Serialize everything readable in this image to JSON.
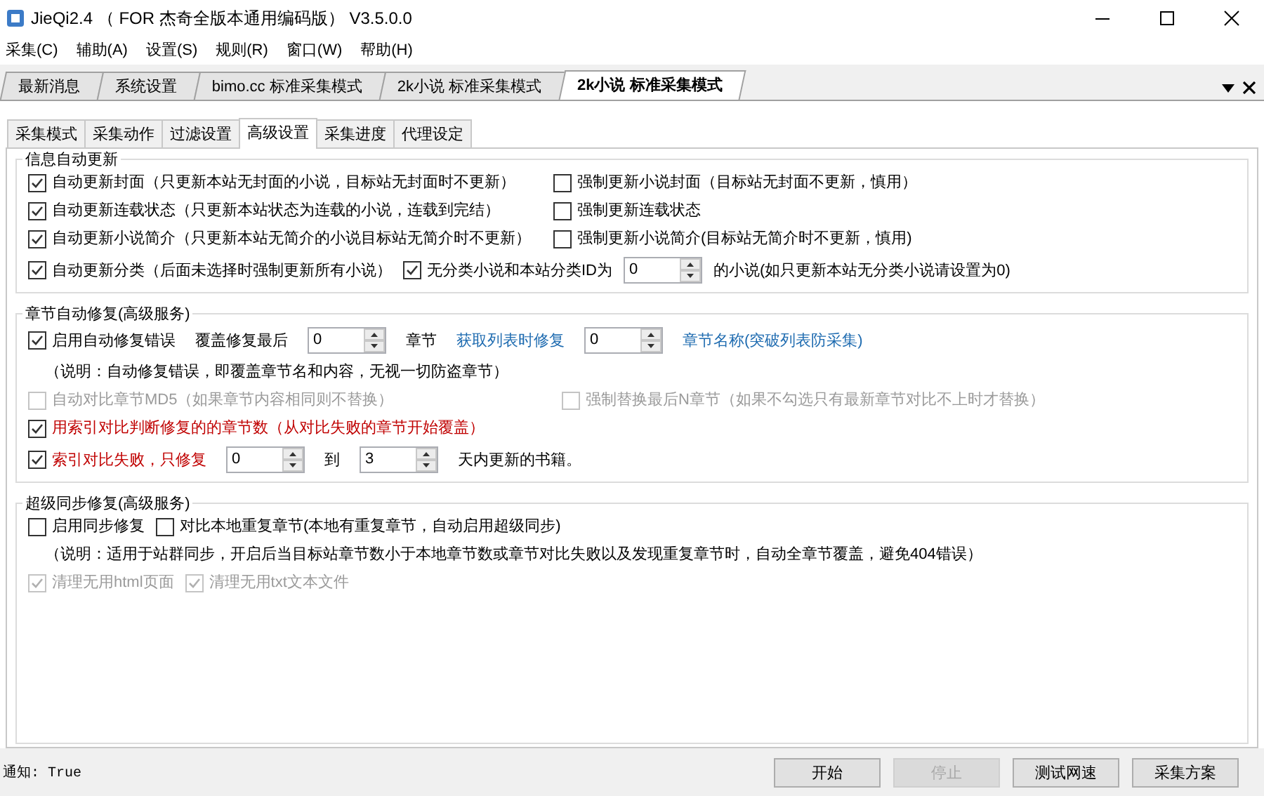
{
  "window": {
    "title": "JieQi2.4 （ FOR 杰奇全版本通用编码版） V3.5.0.0"
  },
  "menu": [
    {
      "label": "采集(C)"
    },
    {
      "label": "辅助(A)"
    },
    {
      "label": "设置(S)"
    },
    {
      "label": "规则(R)"
    },
    {
      "label": "窗口(W)"
    },
    {
      "label": "帮助(H)"
    }
  ],
  "doc_tabs": [
    {
      "label": "最新消息",
      "selected": false
    },
    {
      "label": "系统设置",
      "selected": false
    },
    {
      "label": "bimo.cc 标准采集模式",
      "selected": false
    },
    {
      "label": "2k小说 标准采集模式",
      "selected": false
    },
    {
      "label": "2k小说 标准采集模式",
      "selected": true
    }
  ],
  "sub_tabs": [
    {
      "label": "采集模式",
      "selected": false
    },
    {
      "label": "采集动作",
      "selected": false
    },
    {
      "label": "过滤设置",
      "selected": false
    },
    {
      "label": "高级设置",
      "selected": true
    },
    {
      "label": "采集进度",
      "selected": false
    },
    {
      "label": "代理设定",
      "selected": false
    }
  ],
  "groups": [
    {
      "title": "信息自动更新",
      "rows": [
        {
          "kind": "columns",
          "items": [
            {
              "kind": "check",
              "label": "自动更新封面（只更新本站无封面的小说，目标站无封面时不更新）",
              "checked": true,
              "disabled": false,
              "highlighted": false
            },
            {
              "kind": "check",
              "label": "强制更新小说封面（目标站无封面不更新，慎用）",
              "checked": false,
              "disabled": false,
              "highlighted": false
            }
          ]
        },
        {
          "kind": "columns",
          "items": [
            {
              "kind": "check",
              "label": "自动更新连载状态（只更新本站状态为连载的小说，连载到完结）",
              "checked": true,
              "disabled": false,
              "highlighted": false
            },
            {
              "kind": "check",
              "label": "强制更新连载状态",
              "checked": false,
              "disabled": false,
              "highlighted": false
            }
          ]
        },
        {
          "kind": "columns",
          "items": [
            {
              "kind": "check",
              "label": "自动更新小说简介（只更新本站无简介的小说目标站无简介时不更新）",
              "checked": true,
              "disabled": false,
              "highlighted": false
            },
            {
              "kind": "check",
              "label": "强制更新小说简介(目标站无简介时不更新，慎用)",
              "checked": false,
              "disabled": false,
              "highlighted": false
            }
          ]
        },
        {
          "kind": "flow",
          "items": [
            {
              "kind": "check",
              "label": "自动更新分类（后面未选择时强制更新所有小说）",
              "checked": true,
              "disabled": false,
              "highlighted": false
            },
            {
              "kind": "check",
              "label": "无分类小说和本站分类ID为",
              "checked": true,
              "disabled": false,
              "highlighted": false
            },
            {
              "kind": "spin",
              "value": "0"
            },
            {
              "kind": "text",
              "text": "的小说(如只更新本站无分类小说请设置为0)"
            }
          ]
        }
      ]
    },
    {
      "title": "章节自动修复(高级服务)",
      "rows": [
        {
          "kind": "flow",
          "items": [
            {
              "kind": "check",
              "label": "启用自动修复错误",
              "checked": true,
              "disabled": false,
              "highlighted": false
            },
            {
              "kind": "text",
              "text": "覆盖修复最后"
            },
            {
              "kind": "spin",
              "value": "0"
            },
            {
              "kind": "text",
              "text": "章节"
            },
            {
              "kind": "link",
              "text": "获取列表时修复"
            },
            {
              "kind": "spin",
              "value": "0"
            },
            {
              "kind": "link",
              "text": "章节名称(突破列表防采集)"
            }
          ]
        },
        {
          "kind": "flow",
          "items": [
            {
              "kind": "note",
              "text": "（说明：自动修复错误，即覆盖章节名和内容，无视一切防盗章节）"
            }
          ]
        },
        {
          "kind": "columns",
          "items": [
            {
              "kind": "check",
              "label": "自动对比章节MD5（如果章节内容相同则不替换）",
              "checked": false,
              "disabled": true,
              "highlighted": false
            },
            {
              "kind": "check",
              "label": "强制替换最后N章节（如果不勾选只有最新章节对比不上时才替换）",
              "checked": false,
              "disabled": true,
              "highlighted": false
            }
          ]
        },
        {
          "kind": "flow",
          "items": [
            {
              "kind": "check",
              "label": "用索引对比判断修复的的章节数（从对比失败的章节开始覆盖）",
              "checked": true,
              "disabled": false,
              "highlighted": true
            }
          ]
        },
        {
          "kind": "flow",
          "items": [
            {
              "kind": "check",
              "label": "索引对比失败，只修复",
              "checked": true,
              "disabled": false,
              "highlighted": true
            },
            {
              "kind": "spin",
              "value": "0"
            },
            {
              "kind": "text",
              "text": "到"
            },
            {
              "kind": "spin",
              "value": "3"
            },
            {
              "kind": "text",
              "text": "天内更新的书籍。"
            }
          ]
        }
      ]
    },
    {
      "title": "超级同步修复(高级服务)",
      "rows": [
        {
          "kind": "flow",
          "items": [
            {
              "kind": "check",
              "label": "启用同步修复",
              "checked": false,
              "disabled": false,
              "highlighted": false
            },
            {
              "kind": "check",
              "label": "对比本地重复章节(本地有重复章节，自动启用超级同步)",
              "checked": false,
              "disabled": false,
              "highlighted": false
            }
          ]
        },
        {
          "kind": "flow",
          "items": [
            {
              "kind": "note",
              "text": "（说明：适用于站群同步，开启后当目标站章节数小于本地章节数或章节对比失败以及发现重复章节时，自动全章节覆盖，避免404错误）"
            }
          ]
        },
        {
          "kind": "flow",
          "items": [
            {
              "kind": "check",
              "label": "清理无用html页面",
              "checked": true,
              "disabled": true,
              "highlighted": false
            },
            {
              "kind": "check",
              "label": "清理无用txt文本文件",
              "checked": true,
              "disabled": true,
              "highlighted": false
            }
          ]
        }
      ]
    }
  ],
  "status_bar": {
    "notice": "通知: True"
  },
  "buttons": [
    {
      "label": "开始",
      "disabled": false
    },
    {
      "label": "停止",
      "disabled": true
    },
    {
      "label": "测试网速",
      "disabled": false
    },
    {
      "label": "采集方案",
      "disabled": false
    }
  ]
}
